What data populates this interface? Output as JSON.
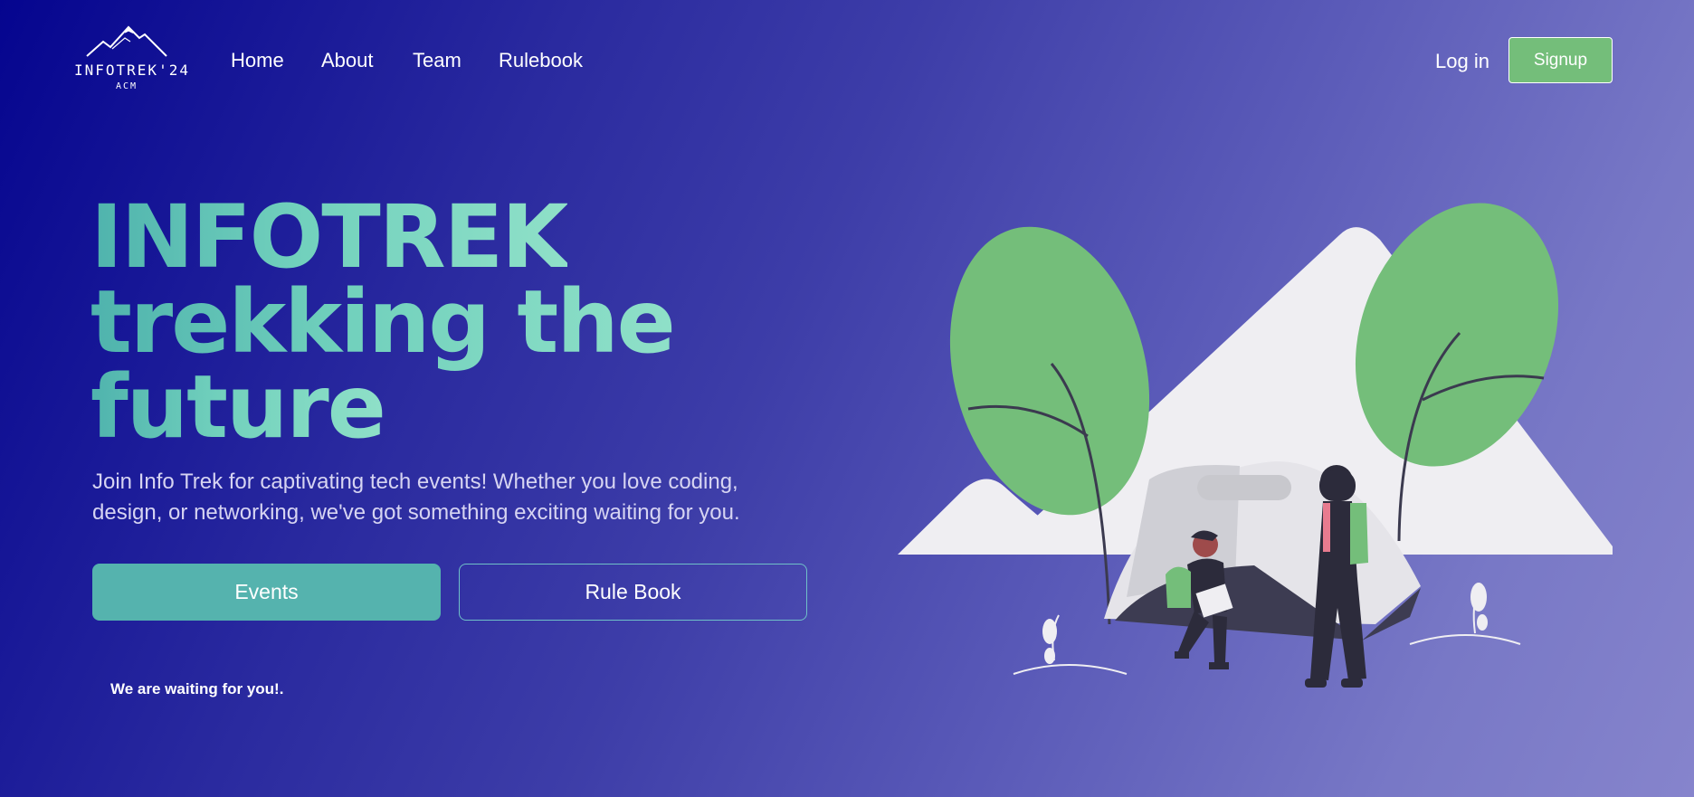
{
  "header": {
    "logo_text": "INFOTREK'24",
    "logo_subtext": "ACM",
    "nav": [
      "Home",
      "About",
      "Team",
      "Rulebook"
    ],
    "login_label": "Log in",
    "signup_label": "Signup"
  },
  "hero": {
    "title": "INFOTREK",
    "line2": "trekking the",
    "line3": "future",
    "description": "Join Info Trek for captivating tech events! Whether you love coding, design, or networking, we've got something exciting waiting for you.",
    "events_label": "Events",
    "rulebook_label": "Rule Book",
    "waiting": "We are waiting for you!."
  },
  "colors": {
    "accent_green": "#74be7a",
    "teal": "#55b3ae",
    "background_dark": "#05058f",
    "background_light": "#8684cc"
  },
  "icons": {
    "logo": "mountain-logo-icon",
    "illustration": "camping-trek-illustration"
  }
}
